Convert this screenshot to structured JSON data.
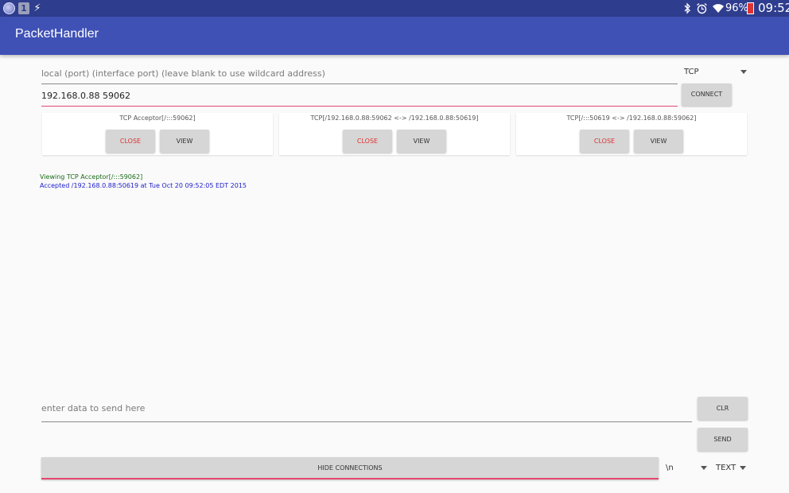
{
  "status_bar": {
    "battery_percent": "96%",
    "time": "09:52",
    "icons": [
      "planet-icon",
      "one-icon",
      "bolt-icon",
      "bluetooth-icon",
      "alarm-icon",
      "wifi-icon",
      "battery-icon"
    ]
  },
  "app_bar": {
    "title": "PacketHandler"
  },
  "connect_form": {
    "local_port_placeholder": "local (port) (interface port) (leave blank to use wildcard address)",
    "address_value": "192.168.0.88 59062",
    "protocol": "TCP",
    "connect_label": "CONNECT"
  },
  "connections": [
    {
      "title": "TCP Acceptor[/:::59062]",
      "close_label": "CLOSE",
      "view_label": "VIEW"
    },
    {
      "title": "TCP[/192.168.0.88:59062 <-> /192.168.0.88:50619]",
      "close_label": "CLOSE",
      "view_label": "VIEW"
    },
    {
      "title": "TCP[/:::50619 <-> /192.168.0.88:59062]",
      "close_label": "CLOSE",
      "view_label": "VIEW"
    }
  ],
  "log": {
    "viewing": "Viewing TCP Acceptor[/:::59062]",
    "accepted": "Accepted /192.168.0.88:50619 at Tue Oct 20 09:52:05 EDT 2015"
  },
  "send_form": {
    "data_placeholder": "enter data to send here",
    "clr_label": "CLR",
    "send_label": "SEND",
    "hide_connections_label": "HIDE CONNECTIONS",
    "line_ending": "\\n",
    "format": "TEXT"
  },
  "colors": {
    "status_bar": "#2f3d8e",
    "app_bar": "#3f51b5",
    "accent": "#e4476f",
    "close_text": "#e03030",
    "log_viewing": "#1a6b1a",
    "log_accepted": "#1c1ccc"
  }
}
